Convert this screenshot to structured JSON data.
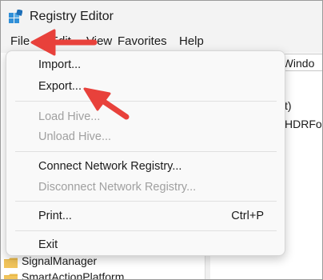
{
  "window": {
    "title": "Registry Editor"
  },
  "menubar": {
    "file": "File",
    "edit_partial": "Edit",
    "view_partial": "View",
    "favorites": "Favorites",
    "help": "Help"
  },
  "address": {
    "value": "ft\\Windo"
  },
  "right_pane": {
    "row1": "t)",
    "row2": "HDRFor"
  },
  "tree": {
    "items": [
      {
        "label": "SignalManager"
      },
      {
        "label": "SmartActionPlatform"
      }
    ]
  },
  "file_menu": {
    "import": "Import...",
    "export": "Export...",
    "load_hive": "Load Hive...",
    "unload_hive": "Unload Hive...",
    "connect": "Connect Network Registry...",
    "disconnect": "Disconnect Network Registry...",
    "print": "Print...",
    "print_shortcut": "Ctrl+P",
    "exit": "Exit"
  },
  "colors": {
    "annotation_arrow": "#e8413b",
    "folder": "#e9b949",
    "app_icon": "#2f8fd8"
  },
  "icons": {
    "app": "registry-editor-icon",
    "folder": "folder-icon",
    "annotation": "red-arrow-annotation"
  }
}
